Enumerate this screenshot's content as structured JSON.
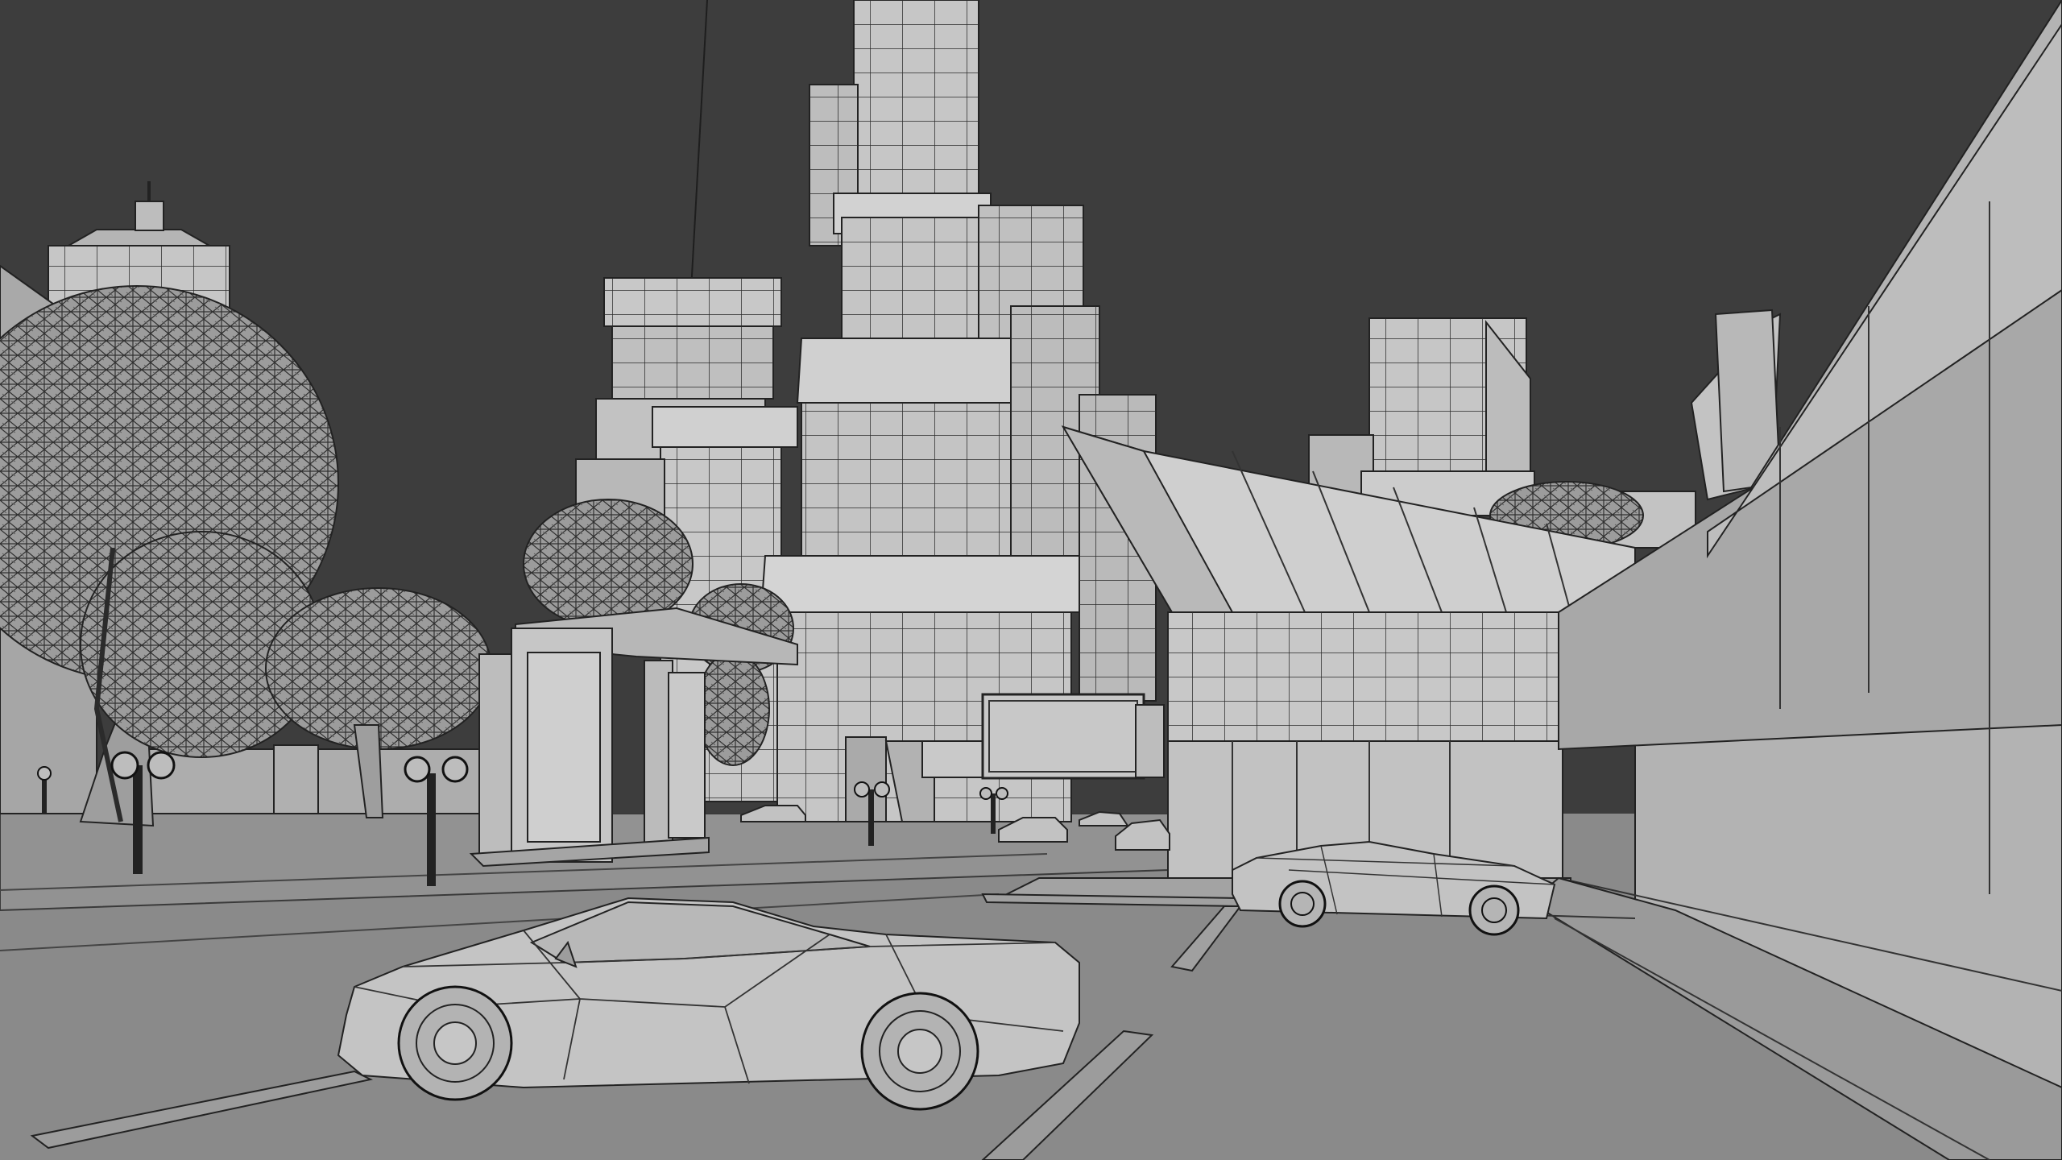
{
  "viewport": {
    "name": "3d-wireframe-city-scene",
    "colors": {
      "sky": "#3d3d3d",
      "ground": "#888888",
      "building": "#c4c4c4",
      "building_shade": "#a8a8a8",
      "wire": "#262626",
      "foliage": "#9a9a9a"
    }
  }
}
